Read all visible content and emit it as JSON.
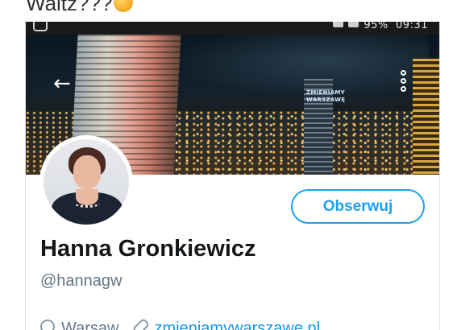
{
  "caption": {
    "text": "Waltz???",
    "emoji": "thinking-face-emoji"
  },
  "status_bar": {
    "battery": "95%",
    "time": "09:31"
  },
  "banner": {
    "neon_sign": "ZMIENIAMY WARSZAWĘ"
  },
  "profile": {
    "name": "Hanna Gronkiewicz",
    "handle": "@hannagw",
    "follow_label": "Obserwuj",
    "location": "Warsaw",
    "website": "zmieniamywarszawe.pl"
  },
  "colors": {
    "accent": "#1da1f2",
    "link": "#1b95e0",
    "secondary_text": "#657786",
    "name_text": "#14171a"
  }
}
